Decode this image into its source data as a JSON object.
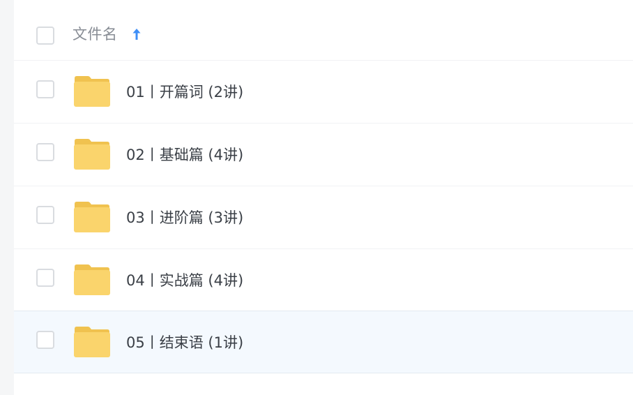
{
  "header": {
    "column_label": "文件名",
    "sort_icon": "arrow-up-icon",
    "sort_direction": "ascending",
    "sort_color": "#3d8ef7"
  },
  "files": [
    {
      "name": "01丨开篇词 (2讲)",
      "icon": "folder-icon",
      "selected": false
    },
    {
      "name": "02丨基础篇 (4讲)",
      "icon": "folder-icon",
      "selected": false
    },
    {
      "name": "03丨进阶篇 (3讲)",
      "icon": "folder-icon",
      "selected": false
    },
    {
      "name": "04丨实战篇 (4讲)",
      "icon": "folder-icon",
      "selected": false
    },
    {
      "name": "05丨结束语 (1讲)",
      "icon": "folder-icon",
      "selected": true
    }
  ],
  "colors": {
    "folder": "#fad46c",
    "folder_tab": "#f0c24f",
    "row_highlight": "#f4f9fe"
  }
}
